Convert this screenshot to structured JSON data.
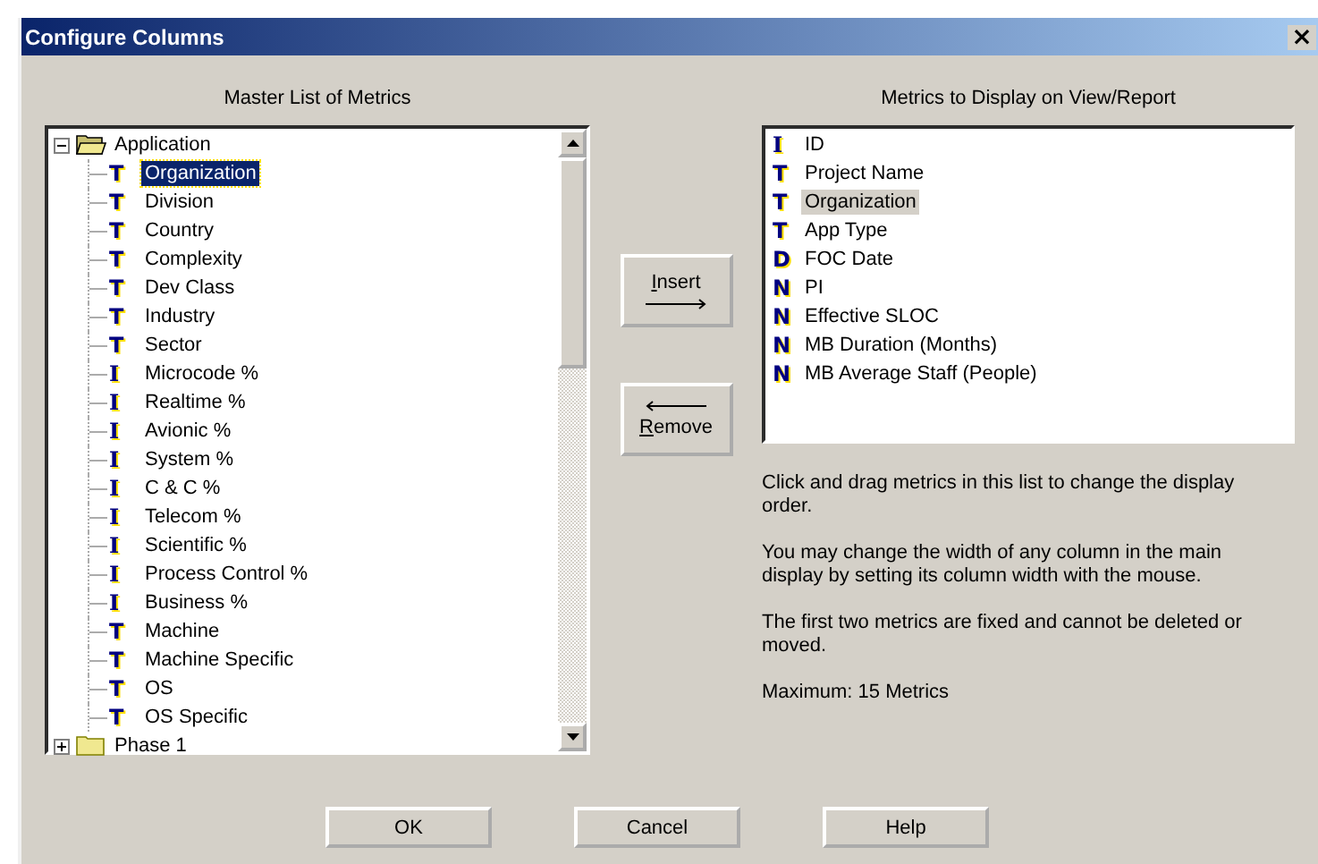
{
  "window": {
    "title": "Configure Columns",
    "close": "×"
  },
  "master": {
    "heading": "Master List of Metrics",
    "tree": [
      {
        "label": "Application",
        "expanded": true,
        "selected": false,
        "children": [
          {
            "glyph": "T",
            "label": "Organization",
            "selected": true
          },
          {
            "glyph": "T",
            "label": "Division",
            "selected": false
          },
          {
            "glyph": "T",
            "label": "Country",
            "selected": false
          },
          {
            "glyph": "T",
            "label": "Complexity",
            "selected": false
          },
          {
            "glyph": "T",
            "label": "Dev Class",
            "selected": false
          },
          {
            "glyph": "T",
            "label": "Industry",
            "selected": false
          },
          {
            "glyph": "T",
            "label": "Sector",
            "selected": false
          },
          {
            "glyph": "I",
            "label": "Microcode %",
            "selected": false
          },
          {
            "glyph": "I",
            "label": "Realtime %",
            "selected": false
          },
          {
            "glyph": "I",
            "label": "Avionic %",
            "selected": false
          },
          {
            "glyph": "I",
            "label": "System %",
            "selected": false
          },
          {
            "glyph": "I",
            "label": "C & C %",
            "selected": false
          },
          {
            "glyph": "I",
            "label": "Telecom %",
            "selected": false
          },
          {
            "glyph": "I",
            "label": "Scientific %",
            "selected": false
          },
          {
            "glyph": "I",
            "label": "Process Control %",
            "selected": false
          },
          {
            "glyph": "I",
            "label": "Business %",
            "selected": false
          },
          {
            "glyph": "T",
            "label": "Machine",
            "selected": false
          },
          {
            "glyph": "T",
            "label": "Machine Specific",
            "selected": false
          },
          {
            "glyph": "T",
            "label": "OS",
            "selected": false
          },
          {
            "glyph": "T",
            "label": "OS Specific",
            "selected": false
          }
        ]
      },
      {
        "label": "Phase 1",
        "expanded": false,
        "selected": false
      }
    ]
  },
  "buttons_middle": [
    {
      "label": "Insert",
      "kind": "right"
    },
    {
      "label": "Remove",
      "kind": "left"
    }
  ],
  "display": {
    "heading": "Metrics to Display on View/Report",
    "items": [
      {
        "glyph": "I",
        "label": "ID",
        "selected": false
      },
      {
        "glyph": "T",
        "label": "Project Name",
        "selected": false
      },
      {
        "glyph": "T",
        "label": "Organization",
        "selected": true
      },
      {
        "glyph": "T",
        "label": "App Type",
        "selected": false
      },
      {
        "glyph": "D",
        "label": "FOC Date",
        "selected": false
      },
      {
        "glyph": "N",
        "label": "PI",
        "selected": false
      },
      {
        "glyph": "N",
        "label": "Effective SLOC",
        "selected": false
      },
      {
        "glyph": "N",
        "label": "MB Duration (Months)",
        "selected": false
      },
      {
        "glyph": "N",
        "label": "MB Average Staff (People)",
        "selected": false
      }
    ]
  },
  "notes": [
    "Click and drag metrics in this list to change the display order.",
    "You may change the width of any column in the main display by setting its column width with the mouse.",
    "The first two metrics are fixed and cannot be deleted or moved.",
    "Maximum: 15 Metrics"
  ],
  "buttons": [
    "OK",
    "Cancel",
    "Help"
  ]
}
